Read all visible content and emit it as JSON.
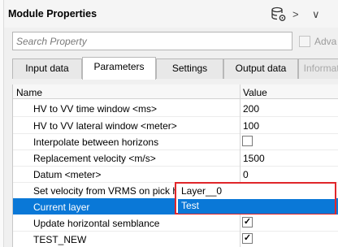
{
  "window": {
    "title": "Module Properties"
  },
  "header_icons": [
    "database-settings-icon",
    "chevron-right-icon",
    "chevron-down-icon"
  ],
  "header_glyphs": {
    "chevron_right": ">",
    "chevron_down": "∨"
  },
  "search": {
    "placeholder": "Search Property",
    "value": ""
  },
  "advanced": {
    "label": "Adva",
    "checked": false
  },
  "tabs": [
    {
      "label": "Input data",
      "active": false,
      "disabled": false
    },
    {
      "label": "Parameters",
      "active": true,
      "disabled": false
    },
    {
      "label": "Settings",
      "active": false,
      "disabled": false
    },
    {
      "label": "Output data",
      "active": false,
      "disabled": false
    },
    {
      "label": "Informati",
      "active": false,
      "disabled": true
    }
  ],
  "grid": {
    "columns": {
      "name": "Name",
      "value": "Value"
    },
    "rows": [
      {
        "name": "HV to VV time window <ms>",
        "value": "200"
      },
      {
        "name": "HV to VV lateral window <meter>",
        "value": "100"
      },
      {
        "name": "Interpolate between horizons",
        "value": "",
        "type": "checkbox",
        "checked": false
      },
      {
        "name": "Replacement velocity <m/s>",
        "value": "1500"
      },
      {
        "name": "Datum <meter>",
        "value": "0"
      },
      {
        "name": "Set velocity from VRMS on pick h",
        "value": ""
      },
      {
        "name": "Current layer",
        "value": "",
        "selected": true
      },
      {
        "name": "Update horizontal semblance",
        "value": "",
        "type": "checkbox",
        "checked": true
      },
      {
        "name": "TEST_NEW",
        "value": "",
        "type": "checkbox",
        "checked": true
      }
    ]
  },
  "dropdown": {
    "options": [
      "Layer__0",
      "Test"
    ],
    "highlighted_index": 1,
    "border_color": "#e0262a"
  },
  "colors": {
    "selection": "#0a78d7"
  }
}
